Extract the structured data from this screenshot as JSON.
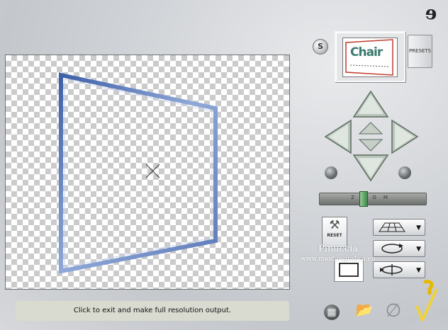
{
  "app": {
    "logo_icon": "bullet-logo-icon",
    "logo_glyph": "ɘ"
  },
  "preview": {
    "background": "transparency-checkerboard",
    "shape": "perspective-frame",
    "frame_color": "#4f70b3",
    "center_marker_icon": "crosshair-icon"
  },
  "thumbnail": {
    "label": "Chair"
  },
  "buttons": {
    "s_label": "S",
    "presets_label": "PRESETS",
    "reset_label": "RESET",
    "zoom_label": "ZOOM"
  },
  "navigation": {
    "up_icon": "arrow-up-icon",
    "down_icon": "arrow-down-icon",
    "left_icon": "arrow-left-icon",
    "right_icon": "arrow-right-icon",
    "small_up_icon": "small-up-icon",
    "small_down_icon": "small-down-icon"
  },
  "mode_buttons": [
    {
      "name": "perspective-mode",
      "icon": "perspective-grid-icon"
    },
    {
      "name": "rotate-mode",
      "icon": "rotate-icon"
    },
    {
      "name": "spin-mode",
      "icon": "spin-icon"
    }
  ],
  "watermark": {
    "line1": "Pinuccia",
    "line2": "www.maidiregrafica.eu"
  },
  "status": {
    "text": "Click to exit and make full resolution output."
  },
  "footer": {
    "grid_icon": "grid-icon",
    "open_icon": "open-folder-icon",
    "cancel_icon": "cancel-icon",
    "ok_icon": "checkmark-icon"
  }
}
